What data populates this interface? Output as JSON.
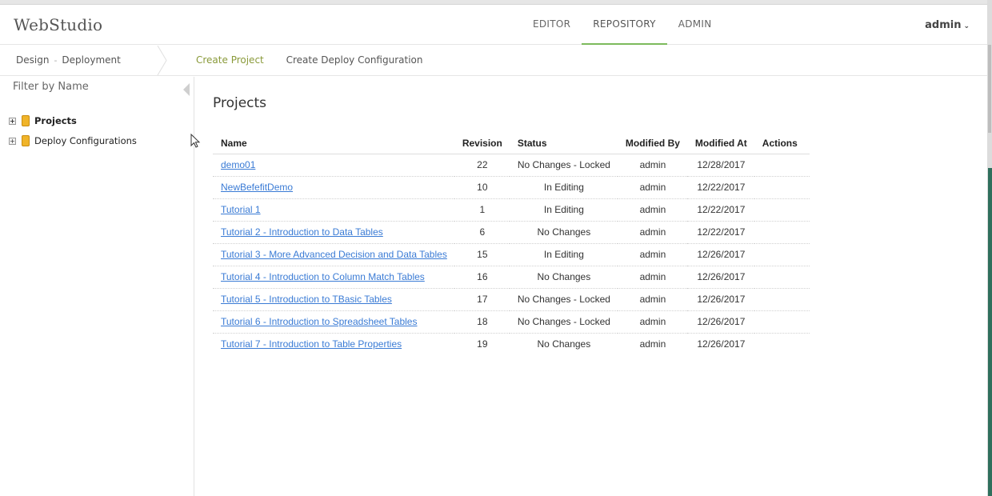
{
  "app": {
    "logo": "WebStudio"
  },
  "nav": {
    "items": [
      {
        "label": "EDITOR",
        "active": false
      },
      {
        "label": "REPOSITORY",
        "active": true
      },
      {
        "label": "ADMIN",
        "active": false
      }
    ],
    "user": "admin",
    "user_chevron": "⌄"
  },
  "subbar": {
    "breadcrumb": [
      "Design",
      "Deployment"
    ],
    "breadcrumb_sep": "-",
    "actions": [
      "Create Project",
      "Create Deploy Configuration"
    ]
  },
  "sidebar": {
    "filter_label": "Filter by Name",
    "tree": [
      {
        "label": "Projects",
        "expand": "+",
        "icon": "folder-icon"
      },
      {
        "label": "Deploy Configurations",
        "expand": "+",
        "icon": "folder-icon"
      }
    ]
  },
  "main": {
    "title": "Projects",
    "columns": [
      "Name",
      "Revision",
      "Status",
      "Modified By",
      "Modified At",
      "Actions"
    ],
    "rows": [
      {
        "name": "demo01",
        "revision": "22",
        "status": "No Changes - Locked",
        "modified_by": "admin",
        "modified_at": "12/28/2017",
        "actions": ""
      },
      {
        "name": "NewBefefitDemo",
        "revision": "10",
        "status": "In Editing",
        "modified_by": "admin",
        "modified_at": "12/22/2017",
        "actions": ""
      },
      {
        "name": "Tutorial 1",
        "revision": "1",
        "status": "In Editing",
        "modified_by": "admin",
        "modified_at": "12/22/2017",
        "actions": ""
      },
      {
        "name": "Tutorial 2 - Introduction to Data Tables",
        "revision": "6",
        "status": "No Changes",
        "modified_by": "admin",
        "modified_at": "12/22/2017",
        "actions": ""
      },
      {
        "name": "Tutorial 3 - More Advanced Decision and Data Tables",
        "revision": "15",
        "status": "In Editing",
        "modified_by": "admin",
        "modified_at": "12/26/2017",
        "actions": ""
      },
      {
        "name": "Tutorial 4 - Introduction to Column Match Tables",
        "revision": "16",
        "status": "No Changes",
        "modified_by": "admin",
        "modified_at": "12/26/2017",
        "actions": ""
      },
      {
        "name": "Tutorial 5 - Introduction to TBasic Tables",
        "revision": "17",
        "status": "No Changes - Locked",
        "modified_by": "admin",
        "modified_at": "12/26/2017",
        "actions": ""
      },
      {
        "name": "Tutorial 6 - Introduction to Spreadsheet Tables",
        "revision": "18",
        "status": "No Changes - Locked",
        "modified_by": "admin",
        "modified_at": "12/26/2017",
        "actions": ""
      },
      {
        "name": "Tutorial 7 - Introduction to Table Properties",
        "revision": "19",
        "status": "No Changes",
        "modified_by": "admin",
        "modified_at": "12/26/2017",
        "actions": ""
      }
    ]
  },
  "colors": {
    "accent_green": "#7cba5c",
    "link_blue": "#3a7bd5",
    "action_green": "#8a9a3a",
    "folder": "#f0b429"
  }
}
